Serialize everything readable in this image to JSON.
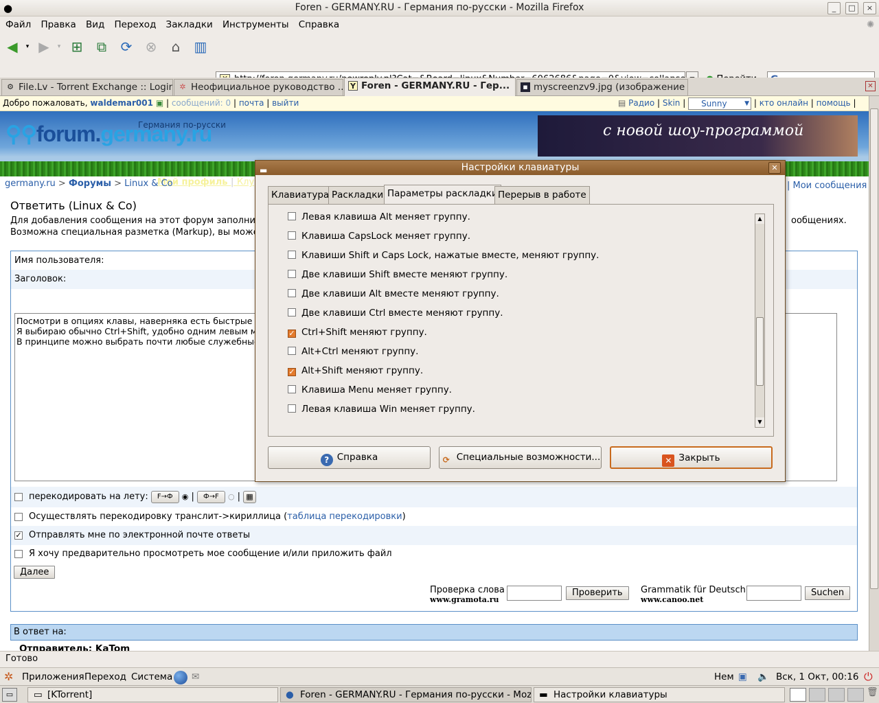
{
  "window": {
    "title": "Foren - GERMANY.RU - Германия по-русски - Mozilla Firefox"
  },
  "menu": [
    "Файл",
    "Правка",
    "Вид",
    "Переход",
    "Закладки",
    "Инструменты",
    "Справка"
  ],
  "nav": {
    "url": "http://foren.germany.ru/newreply.pl?Cat=&Board=linux&Number=6062686&page=0&view=collapsed",
    "go_label": "Перейти",
    "search_logo": "G"
  },
  "tabs": [
    {
      "label": "File.Lv - Torrent Exchange :: Login"
    },
    {
      "label": "Неофициальное руководство ..."
    },
    {
      "label": "Foren - GERMANY.RU - Гер..."
    },
    {
      "label": "myscreenzv9.jpg (изображение ..."
    }
  ],
  "site": {
    "welcome": "Добро пожаловать,",
    "user": "waldemar001",
    "messages": "сообщений: 0",
    "mail": "почта",
    "logout": "выйти",
    "radio": "Радио",
    "skin": "Skin",
    "skin_value": "Sunny",
    "online": "кто онлайн",
    "help": "помощь",
    "logo_a": "forum.",
    "logo_b": "germany.ru",
    "logo_sub": "Германия по-русски",
    "ad_text": "с новой шоу-программой",
    "profile_link": "Мой профиль",
    "club_link": "Клу",
    "breadcrumb_home": "germany.ru",
    "breadcrumb_forums": "Форумы",
    "breadcrumb_board": "Linux & Co",
    "my_messages": "Мои сообщения",
    "page_title": "Ответить (Linux & Co)",
    "intro_line1": "Для добавления сообщения на этот форум заполнит",
    "intro_line1_end": "ообщениях.",
    "intro_line2": "Возможна специальная разметка (Markup), вы может",
    "username_label": "Имя пользователя:",
    "subject_label": "Заголовок:",
    "message_text": "Посмотри в опциях клавы, наверняка есть быстрые к\nЯ выбираю обычно Ctrl+Shift, удобно одним левым м\nВ принципе можно выбрать почти любые служебные к",
    "recode_label": "перекодировать на лету:",
    "recode_btn1": "F→Ф",
    "recode_btn2": "Ф→F",
    "translit_label": "Осуществлять перекодировку транслит->кириллица (",
    "translit_link": "таблица перекодировки",
    "translit_end": ")",
    "email_label": "Отправлять мне по электронной почте ответы",
    "preview_label": "Я хочу предварительно просмотреть мое сообщение и/или приложить файл",
    "next_button": "Далее",
    "spell_label": "Проверка слова",
    "spell_site": "www.gramota.ru",
    "spell_button": "Проверить",
    "grammar_label": "Grammatik für Deutsch",
    "grammar_site": "www.canoo.net",
    "grammar_button": "Suchen",
    "reply_to": "В ответ на:",
    "sender": "Отправитель: KaTom"
  },
  "status": "Готово",
  "panel": {
    "apps": "Приложения",
    "go": "Переход",
    "system": "Система",
    "lang": "Нем",
    "clock": "Вск,  1 Окт, 00:16"
  },
  "tasks": [
    "[KTorrent]",
    "Foren - GERMANY.RU - Германия по-русски - Mozi...",
    "Настройки клавиатуры"
  ],
  "dialog": {
    "title": "Настройки клавиатуры",
    "tabs": [
      "Клавиатура",
      "Раскладки",
      "Параметры раскладки",
      "Перерыв в работе"
    ],
    "options": [
      {
        "label": "Левая клавиша Alt меняет группу.",
        "checked": false
      },
      {
        "label": "Клавиша CapsLock меняет группу.",
        "checked": false
      },
      {
        "label": "Клавиши Shift и Caps Lock, нажатые вместе, меняют группу.",
        "checked": false
      },
      {
        "label": "Две клавиши Shift вместе меняют группу.",
        "checked": false
      },
      {
        "label": "Две клавиши Alt вместе меняют группу.",
        "checked": false
      },
      {
        "label": "Две клавиши Ctrl вместе меняют группу.",
        "checked": false
      },
      {
        "label": "Ctrl+Shift меняют группу.",
        "checked": true
      },
      {
        "label": "Alt+Ctrl меняют группу.",
        "checked": false
      },
      {
        "label": "Alt+Shift меняют группу.",
        "checked": true
      },
      {
        "label": "Клавиша Menu меняет группу.",
        "checked": false
      },
      {
        "label": "Левая клавиша Win меняет группу.",
        "checked": false
      }
    ],
    "help_button": "Справка",
    "access_button": "Специальные возможности...",
    "close_button": "Закрыть"
  }
}
